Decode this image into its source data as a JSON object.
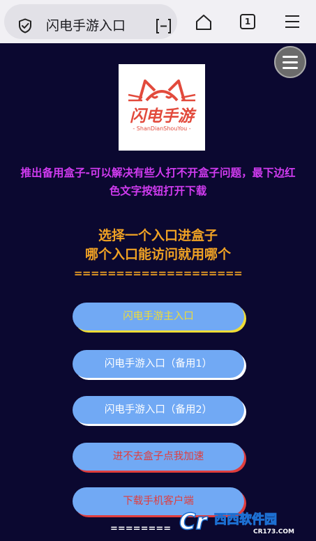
{
  "browser": {
    "address_title": "闪电手游入口",
    "tab_count": "1",
    "icons": [
      "shield-icon",
      "reader-mode-icon",
      "home-icon",
      "tabs-counter",
      "menu-icon"
    ]
  },
  "page": {
    "logo": {
      "brand_cn": "闪电手游",
      "brand_pinyin": "- ShanDianShouYou -"
    },
    "notice_lines": [
      "推出备用盒子-可以解决有些人打不开盒子问题，最下边红",
      "色文字按钮打开下载"
    ],
    "heading_lines": [
      "选择一个入口进盒子",
      "哪个入口能访问就用哪个"
    ],
    "separator": "====================",
    "buttons": [
      {
        "label": "闪电手游主入口",
        "color": "#f0dc36"
      },
      {
        "label": "闪电手游入口（备用1）",
        "color": "#ffffff"
      },
      {
        "label": "闪电手游入口（备用2）",
        "color": "#ffffff"
      },
      {
        "label": "进不去盒子点我加速",
        "color": "#e03d3d"
      },
      {
        "label": "下载手机客户端",
        "color": "#e03d3d"
      }
    ],
    "bottom_separator": "========",
    "colors": {
      "background": "#0b0830",
      "notice": "#d03bf0",
      "heading": "#f0a224",
      "button_fill": "#71a9f4"
    }
  },
  "watermark": {
    "mark": "Cr",
    "site_name": "西西软件园",
    "domain": "CR173.COM"
  }
}
